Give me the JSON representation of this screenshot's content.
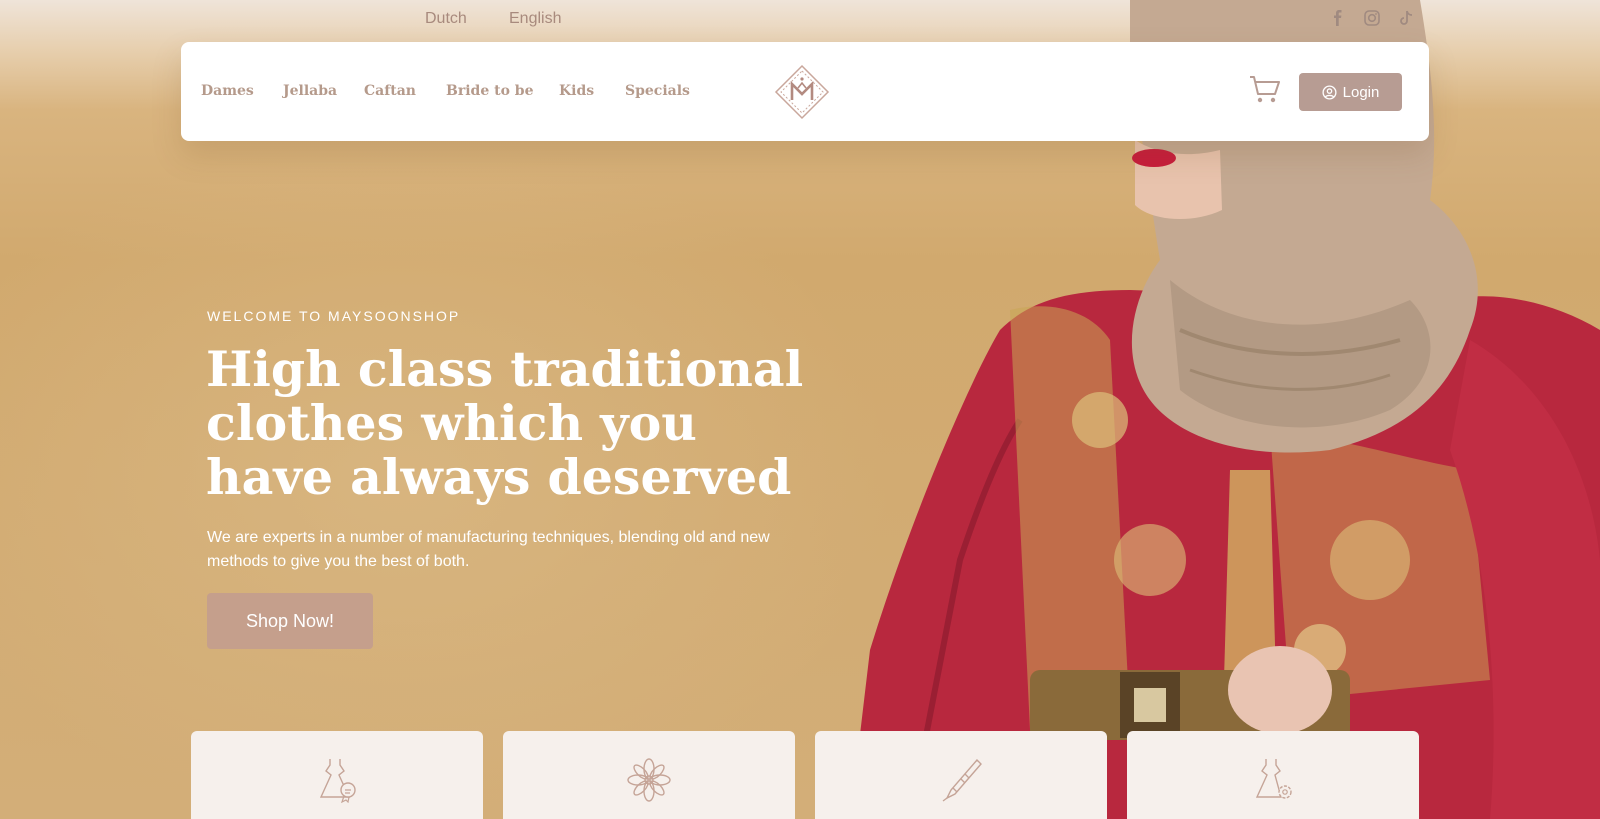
{
  "languages": [
    "Dutch",
    "English"
  ],
  "social": [
    "facebook-icon",
    "instagram-icon",
    "tiktok-icon"
  ],
  "nav": {
    "items": [
      "Dames",
      "Jellaba",
      "Caftan",
      "Bride to be",
      "Kids",
      "Specials"
    ],
    "logo_icon": "maysoon-logo-icon",
    "cart_icon": "cart-icon",
    "login_label": "Login"
  },
  "hero": {
    "eyebrow": "WELCOME TO MAYSOONSHOP",
    "headline": "High class traditional clothes which you have always deserved",
    "subtext": "We are experts in a number of manufacturing techniques, blending old and new methods to give you the best of both.",
    "cta": "Shop Now!"
  },
  "features": [
    {
      "icon": "dress-badge-icon"
    },
    {
      "icon": "flower-icon"
    },
    {
      "icon": "needle-icon"
    },
    {
      "icon": "dress-settings-icon"
    }
  ],
  "colors": {
    "accent": "#b79c93",
    "cta": "#c59f8c",
    "nav_text": "#b59a8b",
    "background": "#d1ab72",
    "card": "#f6f0ec"
  }
}
